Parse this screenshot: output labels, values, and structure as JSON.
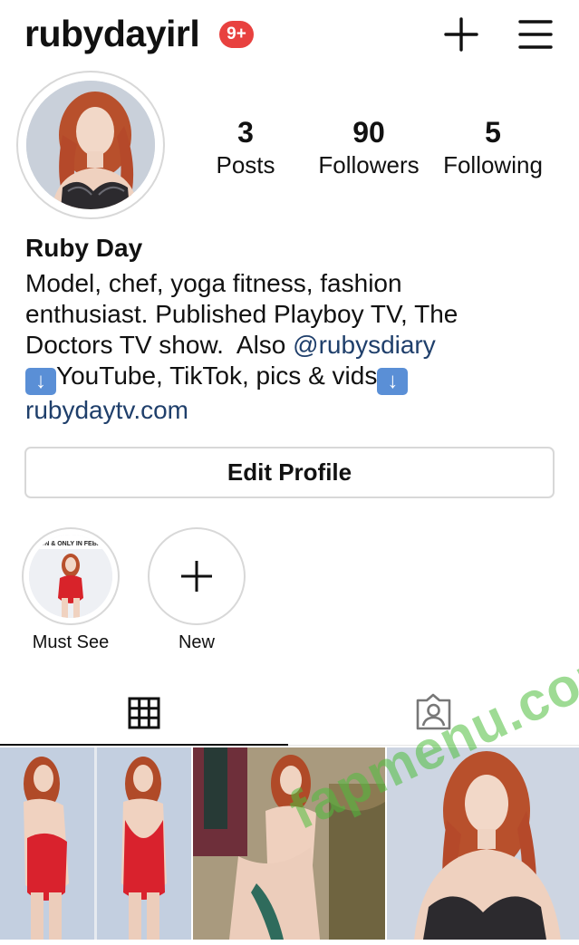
{
  "header": {
    "username": "rubydayirl",
    "notification_badge": "9+",
    "badge_color": "#e8413f",
    "icons": [
      "plus-icon",
      "hamburger-menu-icon"
    ]
  },
  "profile": {
    "stats": [
      {
        "value": "3",
        "label": "Posts"
      },
      {
        "value": "90",
        "label": "Followers"
      },
      {
        "value": "5",
        "label": "Following"
      }
    ],
    "full_name": "Ruby Day",
    "bio": {
      "line1": "Model, chef, yoga fitness, fashion",
      "line2": "enthusiast.  Published Playboy TV, The",
      "line3_text": "Doctors TV show.  Also ",
      "line3_mention": "@rubysdiary",
      "line4_text": "YouTube, TikTok, pics & vids",
      "line4_emoji": "down-arrow-emoji",
      "link": "rubydaytv.com"
    },
    "link_color": "#1f3f6b"
  },
  "edit_profile_label": "Edit Profile",
  "highlights": [
    {
      "label": "Must See",
      "overlay_text": "…UN & ONLY IN FEBR…"
    },
    {
      "label": "New",
      "icon": "plus-icon"
    }
  ],
  "tabs": [
    {
      "name": "grid",
      "icon": "grid-icon",
      "active": true
    },
    {
      "name": "tagged",
      "icon": "tagged-person-icon",
      "active": false
    }
  ],
  "posts": [
    {
      "subject": "two poses in red swimsuit"
    },
    {
      "subject": "seated on patterned chair"
    },
    {
      "subject": "portrait in lace lingerie"
    }
  ],
  "watermark": "fapmenu.com"
}
